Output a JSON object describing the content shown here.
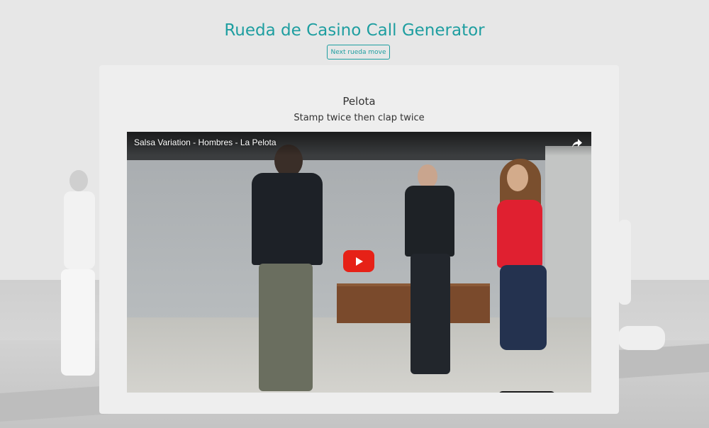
{
  "header": {
    "title": "Rueda de Casino Call Generator",
    "next_button_label": "Next rueda move"
  },
  "move": {
    "name": "Pelota",
    "description": "Stamp twice then clap twice"
  },
  "video": {
    "title": "Salsa Variation - Hombres - La Pelota",
    "share_icon": "share-icon",
    "play_icon": "youtube-play-icon"
  },
  "colors": {
    "accent": "#1e9ea0",
    "play_button": "#e62117"
  }
}
